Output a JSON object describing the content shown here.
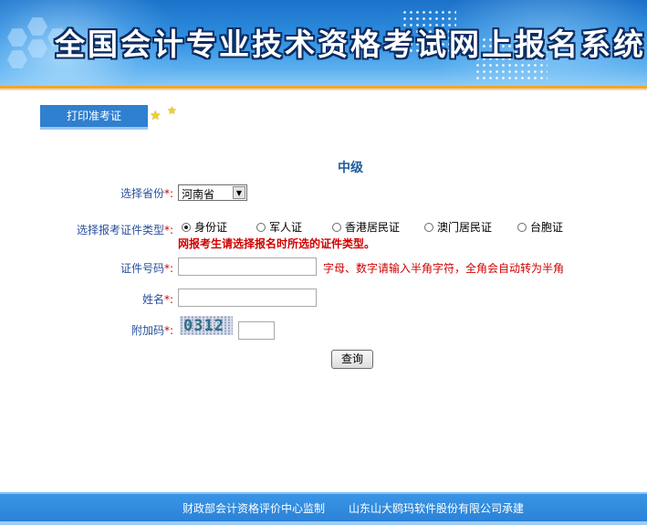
{
  "header": {
    "title": "全国会计专业技术资格考试网上报名系统"
  },
  "tab": {
    "label": "打印准考证"
  },
  "level": "中级",
  "form": {
    "province": {
      "label": "选择省份",
      "required_mark": "*:",
      "value": "河南省"
    },
    "id_type": {
      "label": "选择报考证件类型",
      "required_mark": "*:",
      "options": [
        "身份证",
        "军人证",
        "香港居民证",
        "澳门居民证",
        "台胞证"
      ],
      "selected": "身份证",
      "warning": "网报考生请选择报名时所选的证件类型。"
    },
    "id_number": {
      "label": "证件号码",
      "required_mark": "*:",
      "value": "",
      "hint": "字母、数字请输入半角字符，全角会自动转为半角"
    },
    "name": {
      "label": "姓名",
      "required_mark": "*:",
      "value": ""
    },
    "captcha": {
      "label": "附加码",
      "required_mark": "*:",
      "image_text": "0312",
      "value": ""
    },
    "submit_label": "查询"
  },
  "footer": {
    "supervisor": "财政部会计资格评价中心监制",
    "builder": "山东山大鸥玛软件股份有限公司承建"
  },
  "colors": {
    "banner_blue": "#2f8fe0",
    "accent_orange": "#f5a623",
    "label_blue": "#2a4f9c",
    "warning_red": "#d00000"
  }
}
